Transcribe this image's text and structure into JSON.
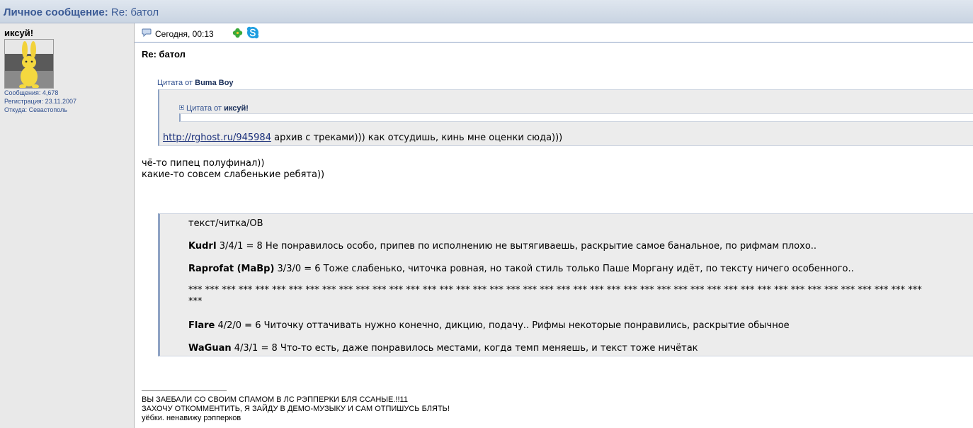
{
  "window": {
    "title_main": "Личное сообщение",
    "title_colon": ":",
    "title_sub": " Re: батол"
  },
  "sidebar": {
    "username": "иксуй!",
    "info": {
      "posts": "Сообщения: 4,678",
      "registered": "Регистрация: 23.11.2007",
      "location": "Откуда: Севастополь"
    }
  },
  "post": {
    "date": "Сегодня, 00:13",
    "title": "Re: батол",
    "outer_quote": {
      "label_prefix": "Цитата от ",
      "author": "Buma Boy",
      "inner_quote": {
        "label_prefix": "Цитата от ",
        "author": "иксуй!"
      },
      "link_text": "http://rghost.ru/945984",
      "text_after_link": " архив с треками))) как отсудишь, кинь мне оценки сюда)))"
    },
    "body_lines": [
      "чё-то пипец полуфинал))",
      "какие-то совсем слабенькие ребята))"
    ],
    "review": {
      "header": "текст/читка/ОВ",
      "entries": [
        {
          "name": "KudrI",
          "text": " 3/4/1 = 8 Не понравилось особо, припев по исполнению не вытягиваешь, раскрытие самое банальное, по рифмам плохо.."
        },
        {
          "name": "Raprofat (MaBp)",
          "text": " 3/3/0 = 6 Тоже слабенько, читочка ровная, но такой стиль только Паше Моргану идёт, по тексту ничего особенного.."
        },
        {
          "name": "Flare",
          "text": " 4/2/0 = 6 Читочку оттачивать нужно конечно, дикцию, подачу.. Рифмы некоторые понравились, раскрытие обычное"
        },
        {
          "name": "WaGuan",
          "text": " 4/3/1 = 8 Что-то есть, даже понравилось местами, когда темп меняешь, и текст тоже ничётак"
        }
      ],
      "separator_line1": "*** *** *** *** *** *** *** *** *** *** *** *** *** *** *** *** *** *** *** *** *** *** *** *** *** *** *** *** *** *** *** *** *** *** *** *** *** *** *** *** *** *** *** ***",
      "separator_line2": "***"
    },
    "signature": [
      "ВЫ ЗАЕБАЛИ СО СВОИМ СПАМОМ В ЛС РЭППЕРКИ БЛЯ ССАНЫЕ.!!11",
      "ЗАХОЧУ ОТКОММЕНТИТЬ, Я ЗАЙДУ В ДЕМО-МУЗЫКУ И САМ ОТПИШУСЬ БЛЯТЬ!",
      "уёбки. ненавижу рэпперков"
    ]
  }
}
